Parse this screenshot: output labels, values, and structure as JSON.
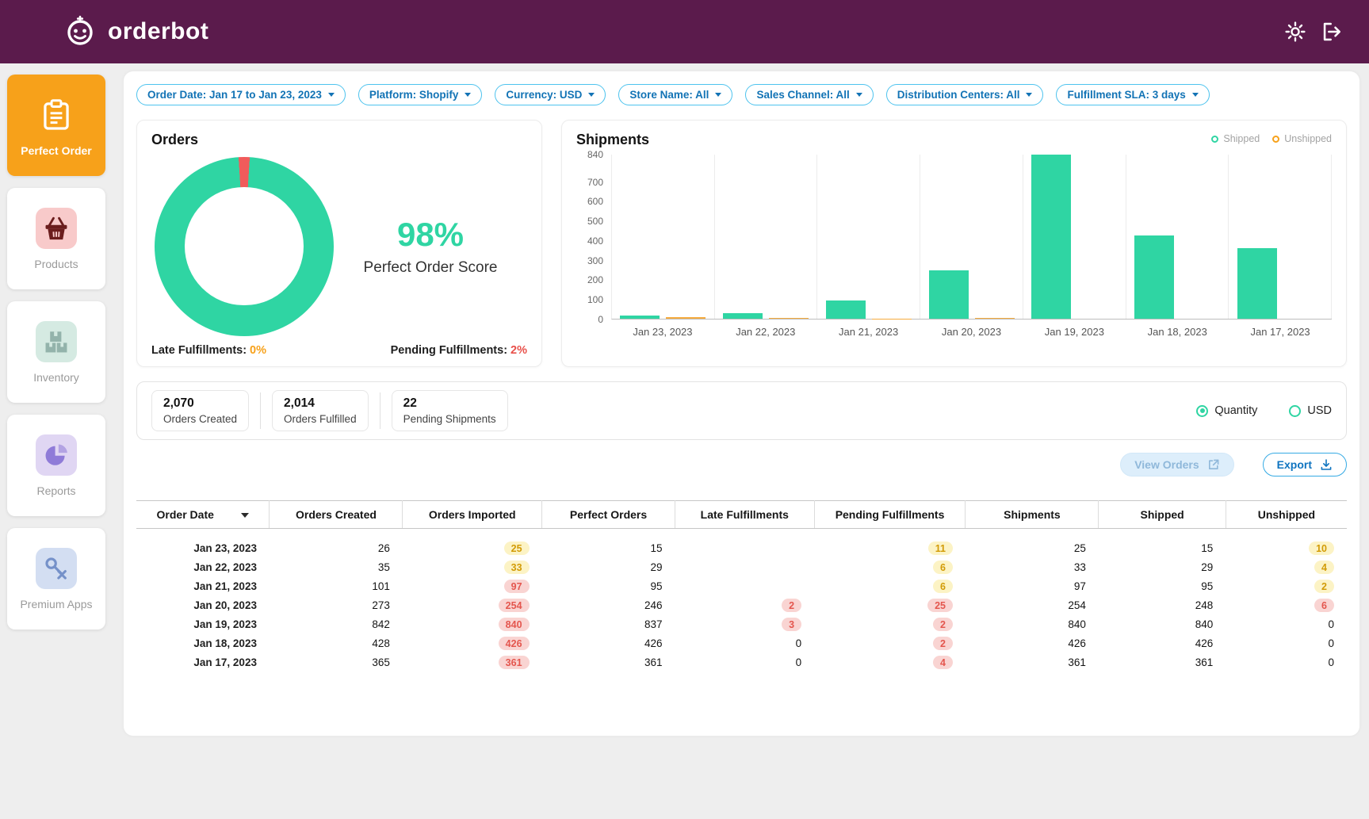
{
  "header": {
    "brand": "orderbot"
  },
  "icons": {
    "topbar": [
      "orderbot-logo-icon",
      "settings-gear-icon",
      "logout-icon"
    ],
    "sidebar": [
      "clipboard-icon",
      "basket-icon",
      "inventory-boxes-icon",
      "pie-chart-icon",
      "premium-apps-icon"
    ],
    "buttons": [
      "external-link-icon",
      "download-icon"
    ]
  },
  "colors": {
    "header_bg": "#5b1b4c",
    "accent_teal": "#2fd5a3",
    "accent_orange": "#f7a11a",
    "accent_red": "#f15b5b",
    "chip_border": "#4ec3ee",
    "chip_text": "#1273b5",
    "badge_yellow_bg": "#fcf3c5",
    "badge_yellow_text": "#d29b06",
    "badge_red_bg": "#f9d4d2",
    "badge_red_text": "#e4564e"
  },
  "sidebar": {
    "items": [
      {
        "label": "Perfect Order",
        "active": true
      },
      {
        "label": "Products",
        "active": false
      },
      {
        "label": "Inventory",
        "active": false
      },
      {
        "label": "Reports",
        "active": false
      },
      {
        "label": "Premium Apps",
        "active": false
      }
    ]
  },
  "filters": [
    "Order Date: Jan 17 to Jan 23, 2023",
    "Platform: Shopify",
    "Currency: USD",
    "Store Name: All",
    "Sales Channel: All",
    "Distribution Centers: All",
    "Fulfillment SLA: 3 days"
  ],
  "orders_card": {
    "title": "Orders",
    "score": "98%",
    "score_label": "Perfect Order Score",
    "late_label": "Late Fulfillments:",
    "late_value": "0%",
    "pending_label": "Pending Fulfillments:",
    "pending_value": "2%"
  },
  "shipments_card": {
    "title": "Shipments"
  },
  "chart_data": [
    {
      "type": "pie",
      "title": "Orders",
      "labels": [
        "Perfect Orders",
        "Not Perfect"
      ],
      "values": [
        98,
        2
      ],
      "colors": [
        "#2fd5a3",
        "#f15b5b"
      ],
      "center_label": "98% Perfect Order Score"
    },
    {
      "type": "bar",
      "title": "Shipments",
      "categories": [
        "Jan 23, 2023",
        "Jan 22, 2023",
        "Jan 21, 2023",
        "Jan 20, 2023",
        "Jan 19, 2023",
        "Jan 18, 2023",
        "Jan 17, 2023"
      ],
      "series": [
        {
          "name": "Shipped",
          "color": "#2fd5a3",
          "values": [
            15,
            29,
            95,
            248,
            840,
            426,
            361
          ]
        },
        {
          "name": "Unshipped",
          "color": "#f6ab3e",
          "values": [
            10,
            4,
            2,
            6,
            0,
            0,
            0
          ]
        }
      ],
      "yticks": [
        840,
        700,
        600,
        500,
        400,
        300,
        200,
        100,
        0
      ],
      "ylim": [
        0,
        840
      ],
      "legend_position": "top-right",
      "grid": "vertical"
    }
  ],
  "stats": [
    {
      "value": "2,070",
      "label": "Orders Created"
    },
    {
      "value": "2,014",
      "label": "Orders Fulfilled"
    },
    {
      "value": "22",
      "label": "Pending Shipments"
    }
  ],
  "unit_toggle": [
    {
      "label": "Quantity",
      "selected": true
    },
    {
      "label": "USD",
      "selected": false
    }
  ],
  "actions": {
    "view_orders": "View Orders",
    "export": "Export"
  },
  "table": {
    "columns": [
      "Order Date",
      "Orders Created",
      "Orders Imported",
      "Perfect Orders",
      "Late Fulfillments",
      "Pending Fulfillments",
      "Shipments",
      "Shipped",
      "Unshipped"
    ],
    "rows": [
      {
        "cells": [
          {
            "v": "Jan 23, 2023"
          },
          {
            "v": "26"
          },
          {
            "v": "25",
            "b": "yellow"
          },
          {
            "v": "15"
          },
          {
            "v": ""
          },
          {
            "v": "11",
            "b": "yellow"
          },
          {
            "v": "25"
          },
          {
            "v": "15"
          },
          {
            "v": "10",
            "b": "yellow"
          }
        ]
      },
      {
        "cells": [
          {
            "v": "Jan 22, 2023"
          },
          {
            "v": "35"
          },
          {
            "v": "33",
            "b": "yellow"
          },
          {
            "v": "29"
          },
          {
            "v": ""
          },
          {
            "v": "6",
            "b": "yellow"
          },
          {
            "v": "33"
          },
          {
            "v": "29"
          },
          {
            "v": "4",
            "b": "yellow"
          }
        ]
      },
      {
        "cells": [
          {
            "v": "Jan 21, 2023"
          },
          {
            "v": "101"
          },
          {
            "v": "97",
            "b": "red"
          },
          {
            "v": "95"
          },
          {
            "v": ""
          },
          {
            "v": "6",
            "b": "yellow"
          },
          {
            "v": "97"
          },
          {
            "v": "95"
          },
          {
            "v": "2",
            "b": "yellow"
          }
        ]
      },
      {
        "cells": [
          {
            "v": "Jan 20, 2023"
          },
          {
            "v": "273"
          },
          {
            "v": "254",
            "b": "red"
          },
          {
            "v": "246"
          },
          {
            "v": "2",
            "b": "red"
          },
          {
            "v": "25",
            "b": "red"
          },
          {
            "v": "254"
          },
          {
            "v": "248"
          },
          {
            "v": "6",
            "b": "red"
          }
        ]
      },
      {
        "cells": [
          {
            "v": "Jan 19, 2023"
          },
          {
            "v": "842"
          },
          {
            "v": "840",
            "b": "red"
          },
          {
            "v": "837"
          },
          {
            "v": "3",
            "b": "red"
          },
          {
            "v": "2",
            "b": "red"
          },
          {
            "v": "840"
          },
          {
            "v": "840"
          },
          {
            "v": "0"
          }
        ]
      },
      {
        "cells": [
          {
            "v": "Jan 18, 2023"
          },
          {
            "v": "428"
          },
          {
            "v": "426",
            "b": "red"
          },
          {
            "v": "426"
          },
          {
            "v": "0"
          },
          {
            "v": "2",
            "b": "red"
          },
          {
            "v": "426"
          },
          {
            "v": "426"
          },
          {
            "v": "0"
          }
        ]
      },
      {
        "cells": [
          {
            "v": "Jan 17, 2023"
          },
          {
            "v": "365"
          },
          {
            "v": "361",
            "b": "red"
          },
          {
            "v": "361"
          },
          {
            "v": "0"
          },
          {
            "v": "4",
            "b": "red"
          },
          {
            "v": "361"
          },
          {
            "v": "361"
          },
          {
            "v": "0"
          }
        ]
      }
    ]
  }
}
